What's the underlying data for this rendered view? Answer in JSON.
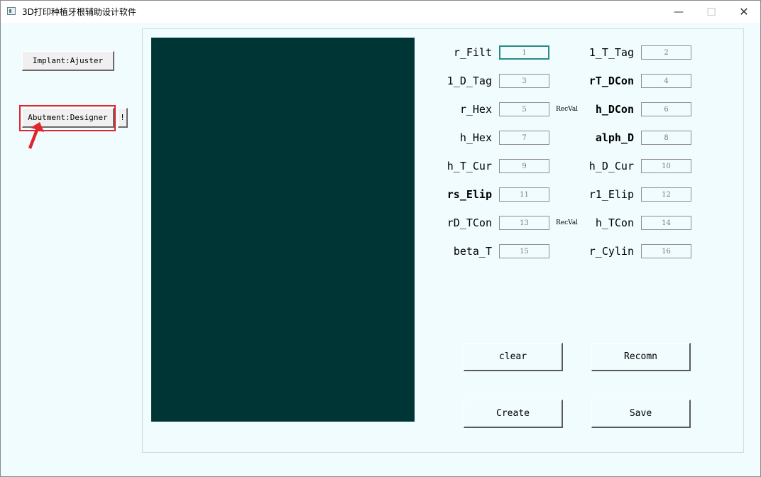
{
  "window": {
    "title": "3D打印种植牙根辅助设计软件",
    "controls": {
      "minimize": "—",
      "maximize": "☐",
      "close": "✕"
    }
  },
  "left_panel": {
    "implant_button": "Implant:Ajuster",
    "abutment_button": "Abutment:Designer",
    "extra_button": "!"
  },
  "params": [
    {
      "label": "r_Filt",
      "value": "1",
      "bold": false
    },
    {
      "label": "1_T_Tag",
      "value": "2",
      "bold": false
    },
    {
      "label": "1_D_Tag",
      "value": "3",
      "bold": false
    },
    {
      "label": "rT_DCon",
      "value": "4",
      "bold": true
    },
    {
      "label": "r_Hex",
      "value": "5",
      "bold": false
    },
    {
      "label": "h_DCon",
      "value": "6",
      "bold": true
    },
    {
      "label": "h_Hex",
      "value": "7",
      "bold": false
    },
    {
      "label": "alph_D",
      "value": "8",
      "bold": true
    },
    {
      "label": "h_T_Cur",
      "value": "9",
      "bold": false
    },
    {
      "label": "h_D_Cur",
      "value": "10",
      "bold": false
    },
    {
      "label": "rs_Elip",
      "value": "11",
      "bold": true
    },
    {
      "label": "r1_Elip",
      "value": "12",
      "bold": false
    },
    {
      "label": "rD_TCon",
      "value": "13",
      "bold": false
    },
    {
      "label": "h_TCon",
      "value": "14",
      "bold": false
    },
    {
      "label": "beta_T",
      "value": "15",
      "bold": false
    },
    {
      "label": "r_Cylin",
      "value": "16",
      "bold": false
    }
  ],
  "recval_labels": [
    "RecVal",
    "RecVal"
  ],
  "actions": {
    "clear": "clear",
    "recomn": "Recomn",
    "create": "Create",
    "save": "Save"
  },
  "colors": {
    "canvas": "#003535",
    "background": "#f0fcfd",
    "highlight": "#e0252b"
  }
}
